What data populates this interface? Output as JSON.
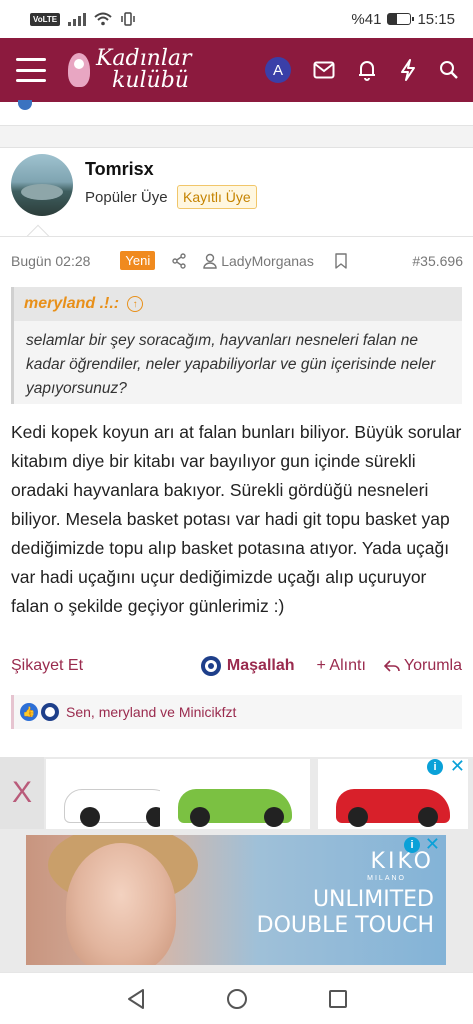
{
  "status_bar": {
    "network": "VoLTE",
    "battery": "%41",
    "battery_level": 0.41,
    "time": "15:15"
  },
  "header": {
    "logo_line1": "Kadınlar",
    "logo_line2": "kulübü",
    "account_initial": "A"
  },
  "post": {
    "username": "Tomrisx",
    "user_title": "Popüler Üye",
    "user_badge": "Kayıtlı Üye",
    "date": "Bugün 02:28",
    "new_badge": "Yeni",
    "mentioned_user": "LadyMorganas",
    "post_number": "#35.696",
    "quote": {
      "author": "meryland .!.:",
      "text": "selamlar bir şey soracağım, hayvanları nesneleri falan ne kadar öğrendiler, neler yapabiliyorlar ve gün içerisinde neler yapıyorsunuz?"
    },
    "body": "Kedi kopek koyun arı at falan bunları biliyor. Büyük sorular kitabım diye bir kitabı var bayılıyor gun içinde sürekli oradaki hayvanlara bakıyor. Sürekli gördüğü nesneleri biliyor. Mesela basket potası var hadi git topu basket yap dediğimizde topu alıp basket potasına atıyor. Yada uçağı var hadi uçağını uçur dediğimizde uçağı alıp uçuruyor falan o şekilde geçiyor günlerimiz :)",
    "actions": {
      "report": "Şikayet Et",
      "mashallah": "Maşallah",
      "quote": "+ Alıntı",
      "reply": "Yorumla"
    },
    "reactions_text": "Sen, meryland ve Minicikfzt"
  },
  "ads": {
    "close_label": "X",
    "banner_brand": "KIKO",
    "banner_brand_sub": "MILANO",
    "banner_line1": "UNLIMITED",
    "banner_line2": "DOUBLE TOUCH",
    "info_symbol": "i",
    "dismiss_symbol": "✕",
    "product_colors": [
      "#ffffff",
      "#7bc142",
      "#d8202a"
    ]
  },
  "colors": {
    "brand": "#8c1a3e",
    "accent_orange": "#f08a1e",
    "link": "#9a2b4e"
  }
}
